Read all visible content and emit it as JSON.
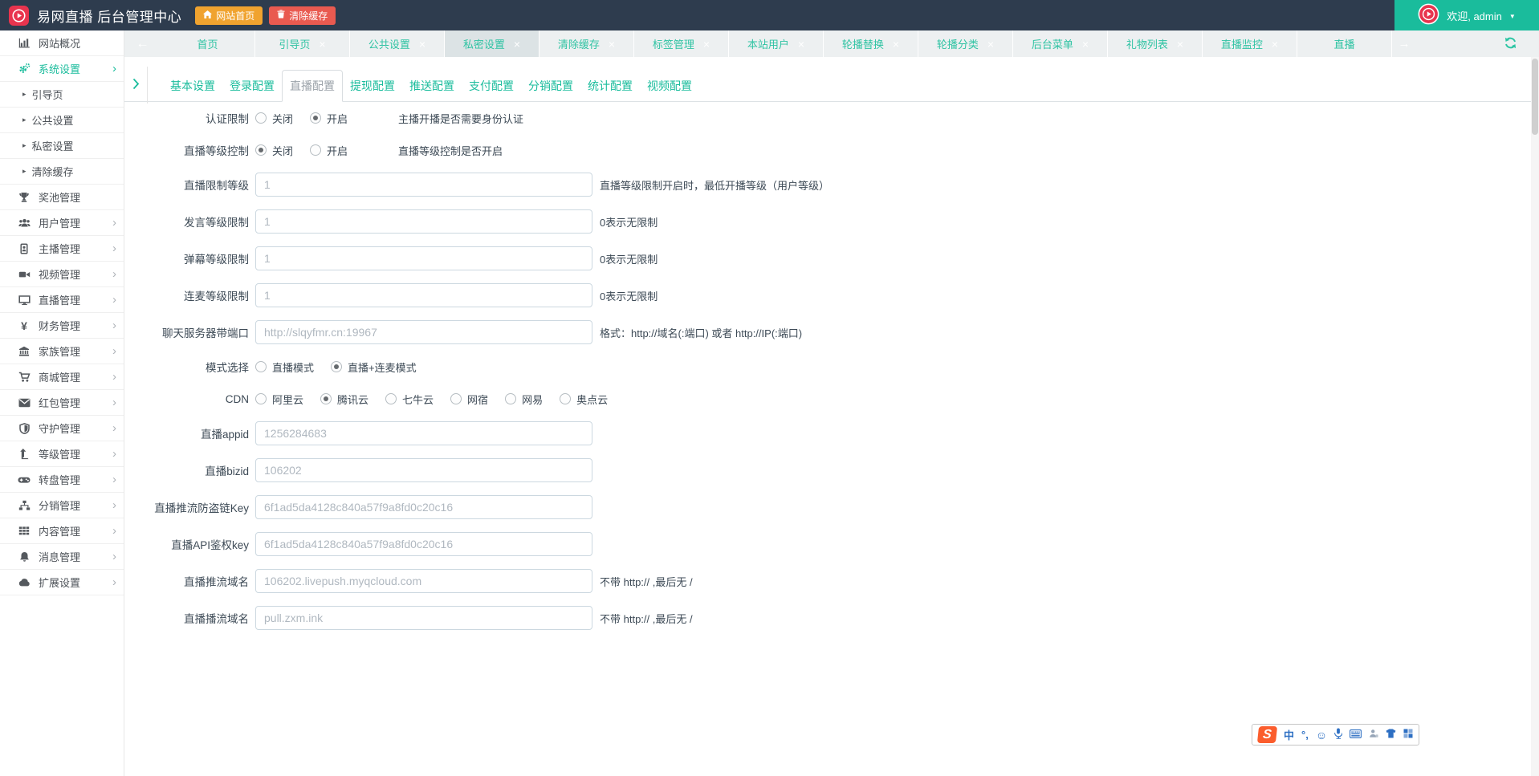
{
  "colors": {
    "accent_teal": "#1abc9c",
    "header_bg": "#2e3c4e",
    "btn_orange": "#f0a32f",
    "btn_red": "#e95a50",
    "logo_red": "#e8344e"
  },
  "header": {
    "title": "易网直播 后台管理中心",
    "home_button": "网站首页",
    "clear_cache_button": "清除缓存",
    "welcome": "欢迎, admin"
  },
  "tabbar": {
    "tabs": [
      {
        "label": "首页",
        "closable": false
      },
      {
        "label": "引导页",
        "closable": true
      },
      {
        "label": "公共设置",
        "closable": true
      },
      {
        "label": "私密设置",
        "closable": true,
        "active": true
      },
      {
        "label": "清除缓存",
        "closable": true
      },
      {
        "label": "标签管理",
        "closable": true
      },
      {
        "label": "本站用户",
        "closable": true
      },
      {
        "label": "轮播替换",
        "closable": true
      },
      {
        "label": "轮播分类",
        "closable": true
      },
      {
        "label": "后台菜单",
        "closable": true
      },
      {
        "label": "礼物列表",
        "closable": true
      },
      {
        "label": "直播监控",
        "closable": true
      },
      {
        "label": "直播",
        "closable": false
      }
    ]
  },
  "sidebar": {
    "items": [
      {
        "label": "网站概况",
        "icon": "bar-chart"
      },
      {
        "label": "系统设置",
        "icon": "gears",
        "active": true,
        "expandable": true
      },
      {
        "label": "引导页",
        "sub": true
      },
      {
        "label": "公共设置",
        "sub": true
      },
      {
        "label": "私密设置",
        "sub": true
      },
      {
        "label": "清除缓存",
        "sub": true
      },
      {
        "label": "奖池管理",
        "icon": "trophy"
      },
      {
        "label": "用户管理",
        "icon": "users",
        "expandable": true
      },
      {
        "label": "主播管理",
        "icon": "id-card",
        "expandable": true
      },
      {
        "label": "视频管理",
        "icon": "video-camera",
        "expandable": true
      },
      {
        "label": "直播管理",
        "icon": "monitor",
        "expandable": true
      },
      {
        "label": "财务管理",
        "icon": "yen",
        "expandable": true
      },
      {
        "label": "家族管理",
        "icon": "bank",
        "expandable": true
      },
      {
        "label": "商城管理",
        "icon": "cart",
        "expandable": true
      },
      {
        "label": "红包管理",
        "icon": "envelope",
        "expandable": true
      },
      {
        "label": "守护管理",
        "icon": "shield",
        "expandable": true
      },
      {
        "label": "等级管理",
        "icon": "level-up",
        "expandable": true
      },
      {
        "label": "转盘管理",
        "icon": "gamepad",
        "expandable": true
      },
      {
        "label": "分销管理",
        "icon": "sitemap",
        "expandable": true
      },
      {
        "label": "内容管理",
        "icon": "grid",
        "expandable": true
      },
      {
        "label": "消息管理",
        "icon": "bell",
        "expandable": true
      },
      {
        "label": "扩展设置",
        "icon": "cloud",
        "expandable": true
      }
    ]
  },
  "subtabs": {
    "items": [
      "基本设置",
      "登录配置",
      "直播配置",
      "提现配置",
      "推送配置",
      "支付配置",
      "分销配置",
      "统计配置",
      "视频配置"
    ],
    "active": "直播配置"
  },
  "form": {
    "rows": [
      {
        "type": "radio",
        "label": "认证限制",
        "options": [
          {
            "text": "关闭",
            "checked": false
          },
          {
            "text": "开启",
            "checked": true
          }
        ],
        "hint": "主播开播是否需要身份认证"
      },
      {
        "type": "radio",
        "label": "直播等级控制",
        "options": [
          {
            "text": "关闭",
            "checked": true
          },
          {
            "text": "开启",
            "checked": false
          }
        ],
        "hint": "直播等级控制是否开启"
      },
      {
        "type": "input",
        "label": "直播限制等级",
        "value": "1",
        "hint": "直播等级限制开启时，最低开播等级（用户等级）"
      },
      {
        "type": "input",
        "label": "发言等级限制",
        "value": "1",
        "hint": "0表示无限制"
      },
      {
        "type": "input",
        "label": "弹幕等级限制",
        "value": "1",
        "hint": "0表示无限制"
      },
      {
        "type": "input",
        "label": "连麦等级限制",
        "value": "1",
        "hint": "0表示无限制"
      },
      {
        "type": "input",
        "label": "聊天服务器带端口",
        "value": "http://slqyfmr.cn:19967",
        "hint": "格式：http://域名(:端口) 或者 http://IP(:端口)"
      },
      {
        "type": "radio",
        "label": "模式选择",
        "options": [
          {
            "text": "直播模式",
            "checked": false
          },
          {
            "text": "直播+连麦模式",
            "checked": true
          }
        ],
        "hint": ""
      },
      {
        "type": "radio",
        "label": "CDN",
        "options": [
          {
            "text": "阿里云",
            "checked": false
          },
          {
            "text": "腾讯云",
            "checked": true
          },
          {
            "text": "七牛云",
            "checked": false
          },
          {
            "text": "网宿",
            "checked": false
          },
          {
            "text": "网易",
            "checked": false
          },
          {
            "text": "奥点云",
            "checked": false
          }
        ],
        "hint": ""
      },
      {
        "type": "input",
        "label": "直播appid",
        "value": "1256284683",
        "hint": ""
      },
      {
        "type": "input",
        "label": "直播bizid",
        "value": "106202",
        "hint": ""
      },
      {
        "type": "input",
        "label": "直播推流防盗链Key",
        "value": "6f1ad5da4128c840a57f9a8fd0c20c16",
        "hint": ""
      },
      {
        "type": "input",
        "label": "直播API鉴权key",
        "value": "6f1ad5da4128c840a57f9a8fd0c20c16",
        "hint": ""
      },
      {
        "type": "input",
        "label": "直播推流域名",
        "value": "106202.livepush.myqcloud.com",
        "hint": "不带 http:// ,最后无 /"
      },
      {
        "type": "input",
        "label": "直播播流域名",
        "value": "pull.zxm.ink",
        "hint": "不带 http:// ,最后无 /"
      }
    ]
  },
  "ime": {
    "mode": "中",
    "punct": "°,",
    "smiley": "☺"
  }
}
